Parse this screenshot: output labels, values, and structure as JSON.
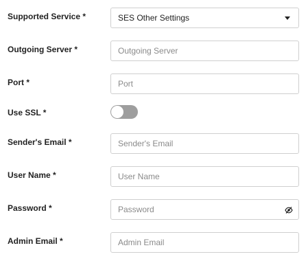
{
  "form": {
    "supported_service": {
      "label": "Supported Service *",
      "value": "SES Other Settings"
    },
    "outgoing_server": {
      "label": "Outgoing Server *",
      "placeholder": "Outgoing Server",
      "value": ""
    },
    "port": {
      "label": "Port *",
      "placeholder": "Port",
      "value": ""
    },
    "use_ssl": {
      "label": "Use SSL *",
      "checked": false
    },
    "senders_email": {
      "label": "Sender's Email *",
      "placeholder": "Sender's Email",
      "value": ""
    },
    "user_name": {
      "label": "User Name *",
      "placeholder": "User Name",
      "value": ""
    },
    "password": {
      "label": "Password *",
      "placeholder": "Password",
      "value": ""
    },
    "admin_email": {
      "label": "Admin Email *",
      "placeholder": "Admin Email",
      "value": ""
    }
  },
  "icons": {
    "dropdown": "chevron-down-icon",
    "password_toggle": "eye-slash-icon"
  },
  "colors": {
    "toggle_off": "#9e9e9e",
    "border": "#cfcfcf",
    "placeholder": "#8a8a8a"
  }
}
